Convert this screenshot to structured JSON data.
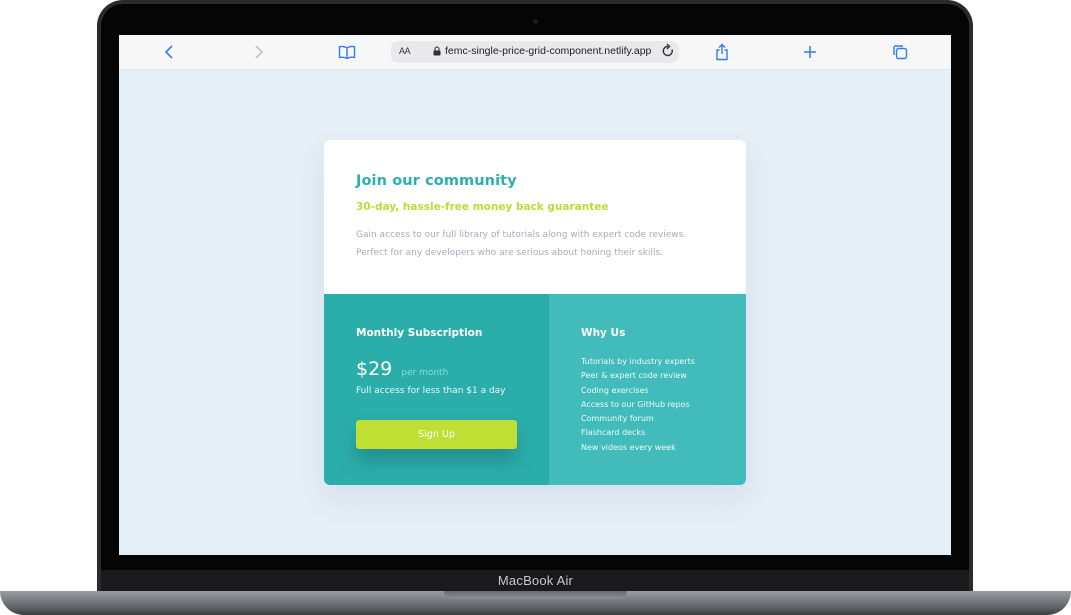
{
  "device": {
    "label": "MacBook Air"
  },
  "browser": {
    "url": "femc-single-price-grid-component.netlify.app",
    "reader_label": "AA",
    "icons": {
      "back": "chevron-left-icon",
      "forward": "chevron-right-icon",
      "bookmarks": "book-icon",
      "lock": "lock-icon",
      "reload": "reload-icon",
      "share": "share-icon",
      "new_tab": "plus-icon",
      "tabs": "tabs-icon"
    },
    "accent_color": "#2f7cf6"
  },
  "card": {
    "title": "Join our community",
    "subtitle": "30-day, hassle-free money back guarantee",
    "description": "Gain access to our full library of tutorials along with expert code reviews. Perfect for any developers who are serious about honing their skills.",
    "subscription": {
      "heading": "Monthly Subscription",
      "price": "$29",
      "per": "per month",
      "access": "Full access for less than $1 a day",
      "button_label": "Sign Up"
    },
    "why": {
      "heading": "Why Us",
      "items": [
        "Tutorials by industry experts",
        "Peer & expert code review",
        "Coding exercises",
        "Access to our GitHub repos",
        "Community forum",
        "Flashcard decks",
        "New videos every week"
      ]
    },
    "colors": {
      "cyan": "#2bb0ad",
      "light_cyan": "#41bcbb",
      "yellow": "#bfd83a",
      "gray_blue": "#a6abbd",
      "page_bg": "#e6eef6"
    }
  }
}
